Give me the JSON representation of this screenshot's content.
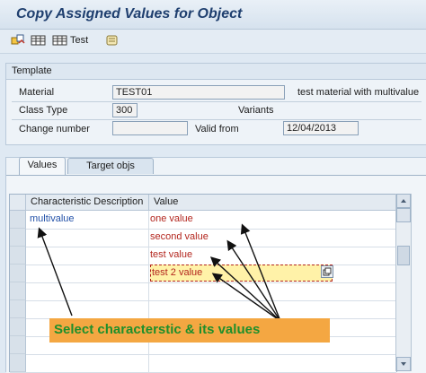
{
  "window": {
    "title": "Copy Assigned Values for Object"
  },
  "toolbar": {
    "items": [
      {
        "icon": "copy-structure-icon"
      },
      {
        "icon": "table-select-icon"
      },
      {
        "icon": "table-test-icon",
        "label": "Test"
      },
      {
        "icon": "scroll-document-icon"
      }
    ]
  },
  "template": {
    "title": "Template",
    "material_label": "Material",
    "material_value": "TEST01",
    "material_description": "test material with multivalue",
    "class_type_label": "Class Type",
    "class_type_value": "300",
    "variants_label": "Variants",
    "change_number_label": "Change number",
    "change_number_value": "",
    "valid_from_label": "Valid from",
    "valid_from_value": "12/04/2013"
  },
  "tabs": [
    {
      "label": "Values",
      "active": true
    },
    {
      "label": "Target objs",
      "active": false
    }
  ],
  "grid": {
    "columns": [
      "Characteristic Description",
      "Value"
    ],
    "rows": [
      {
        "characteristic": "multivalue",
        "value": "one value"
      },
      {
        "characteristic": "",
        "value": "second value"
      },
      {
        "characteristic": "",
        "value": "test value"
      },
      {
        "characteristic": "",
        "value": "test 2 value",
        "selected": true
      },
      {
        "characteristic": "",
        "value": ""
      },
      {
        "characteristic": "",
        "value": ""
      },
      {
        "characteristic": "",
        "value": ""
      },
      {
        "characteristic": "",
        "value": ""
      },
      {
        "characteristic": "",
        "value": ""
      }
    ]
  },
  "annotation": {
    "text": "Select characterstic & its values"
  },
  "colors": {
    "title": "#1f3f6f",
    "value_text": "#b3261e",
    "link_text": "#2251a8",
    "callout_bg": "#f4a742",
    "callout_text": "#1f8f2b",
    "highlight": "#fff2a8"
  }
}
